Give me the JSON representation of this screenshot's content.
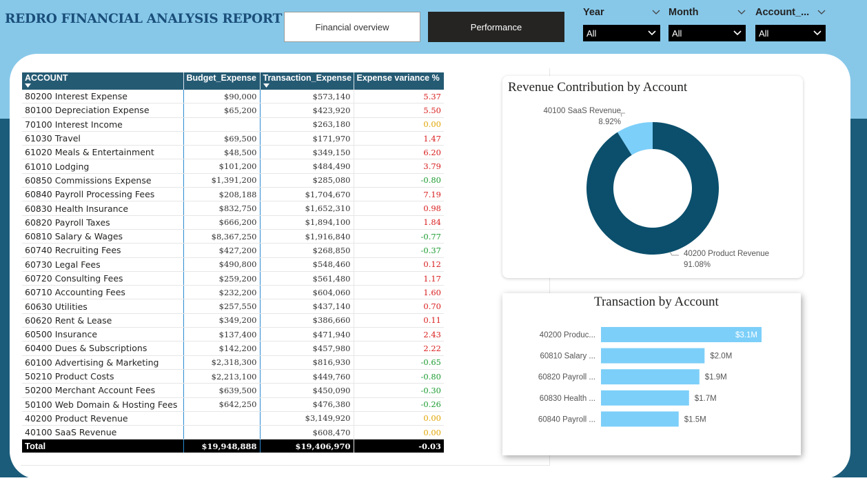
{
  "header": {
    "title": "REDRO FINANCIAL ANALYSIS REPORT",
    "nav": {
      "financial_overview": "Financial overview",
      "performance": "Performance"
    }
  },
  "slicers": [
    {
      "label": "Year",
      "value": "All"
    },
    {
      "label": "Month",
      "value": "All"
    },
    {
      "label": "Account_...",
      "value": "All"
    }
  ],
  "table": {
    "columns": [
      "ACCOUNT",
      "Budget_Expense",
      "Transaction_Expense",
      "Expense variance %"
    ],
    "rows": [
      {
        "account": "80200 Interest Expense",
        "budget": "$90,000",
        "transaction": "$573,140",
        "variance": "5.37"
      },
      {
        "account": "80100 Depreciation Expense",
        "budget": "$65,200",
        "transaction": "$423,920",
        "variance": "5.50"
      },
      {
        "account": "70100 Interest Income",
        "budget": "",
        "transaction": "$263,180",
        "variance": "0.00"
      },
      {
        "account": "61030 Travel",
        "budget": "$69,500",
        "transaction": "$171,970",
        "variance": "1.47"
      },
      {
        "account": "61020 Meals & Entertainment",
        "budget": "$48,500",
        "transaction": "$349,150",
        "variance": "6.20"
      },
      {
        "account": "61010 Lodging",
        "budget": "$101,200",
        "transaction": "$484,490",
        "variance": "3.79"
      },
      {
        "account": "60850 Commissions Expense",
        "budget": "$1,391,200",
        "transaction": "$285,080",
        "variance": "-0.80"
      },
      {
        "account": "60840 Payroll Processing Fees",
        "budget": "$208,188",
        "transaction": "$1,704,670",
        "variance": "7.19"
      },
      {
        "account": "60830 Health Insurance",
        "budget": "$832,750",
        "transaction": "$1,652,310",
        "variance": "0.98"
      },
      {
        "account": "60820 Payroll Taxes",
        "budget": "$666,200",
        "transaction": "$1,894,100",
        "variance": "1.84"
      },
      {
        "account": "60810 Salary & Wages",
        "budget": "$8,367,250",
        "transaction": "$1,916,840",
        "variance": "-0.77"
      },
      {
        "account": "60740 Recruiting Fees",
        "budget": "$427,200",
        "transaction": "$268,850",
        "variance": "-0.37"
      },
      {
        "account": "60730 Legal Fees",
        "budget": "$490,800",
        "transaction": "$548,460",
        "variance": "0.12"
      },
      {
        "account": "60720 Consulting Fees",
        "budget": "$259,200",
        "transaction": "$561,480",
        "variance": "1.17"
      },
      {
        "account": "60710 Accounting Fees",
        "budget": "$232,200",
        "transaction": "$604,060",
        "variance": "1.60"
      },
      {
        "account": "60630 Utilities",
        "budget": "$257,550",
        "transaction": "$437,140",
        "variance": "0.70"
      },
      {
        "account": "60620 Rent & Lease",
        "budget": "$349,200",
        "transaction": "$386,660",
        "variance": "0.11"
      },
      {
        "account": "60500 Insurance",
        "budget": "$137,400",
        "transaction": "$471,940",
        "variance": "2.43"
      },
      {
        "account": "60400 Dues & Subscriptions",
        "budget": "$142,200",
        "transaction": "$457,980",
        "variance": "2.22"
      },
      {
        "account": "60100 Advertising & Marketing",
        "budget": "$2,318,300",
        "transaction": "$816,930",
        "variance": "-0.65"
      },
      {
        "account": "50210 Product Costs",
        "budget": "$2,213,100",
        "transaction": "$449,760",
        "variance": "-0.80"
      },
      {
        "account": "50200 Merchant Account Fees",
        "budget": "$639,500",
        "transaction": "$450,090",
        "variance": "-0.30"
      },
      {
        "account": "50100 Web Domain & Hosting Fees",
        "budget": "$642,250",
        "transaction": "$476,380",
        "variance": "-0.26"
      },
      {
        "account": "40200 Product Revenue",
        "budget": "",
        "transaction": "$3,149,920",
        "variance": "0.00"
      },
      {
        "account": "40100 SaaS Revenue",
        "budget": "",
        "transaction": "$608,470",
        "variance": "0.00"
      }
    ],
    "total": {
      "account": "Total",
      "budget": "$19,948,888",
      "transaction": "$19,406,970",
      "variance": "-0.03"
    }
  },
  "colors": {
    "header_band": "#87c8e9",
    "deep_teal": "#1b5c7a",
    "table_header": "#255a73",
    "positive_variance": "#d91c1c",
    "negative_variance": "#1a9b2f",
    "zero_variance": "#e1a400",
    "donut_main": "#0b4f6c",
    "donut_small": "#7ccff9",
    "bar": "#7ccff9"
  },
  "chart_data": [
    {
      "type": "pie",
      "title": "Revenue Contribution by Account",
      "categories": [
        "40200 Product Revenue",
        "40100 SaaS Revenue"
      ],
      "values": [
        91.08,
        8.92
      ],
      "labels": [
        "91.08%",
        "8.92%"
      ],
      "colors": [
        "#0b4f6c",
        "#7ccff9"
      ]
    },
    {
      "type": "bar",
      "title": "Transaction by Account",
      "categories": [
        "40200 Produc...",
        "60810 Salary ...",
        "60820 Payroll ...",
        "60830 Health ...",
        "60840 Payroll ..."
      ],
      "values": [
        3.1,
        2.0,
        1.9,
        1.7,
        1.5
      ],
      "labels": [
        "$3.1M",
        "$2.0M",
        "$1.9M",
        "$1.7M",
        "$1.5M"
      ],
      "unit": "M"
    }
  ]
}
